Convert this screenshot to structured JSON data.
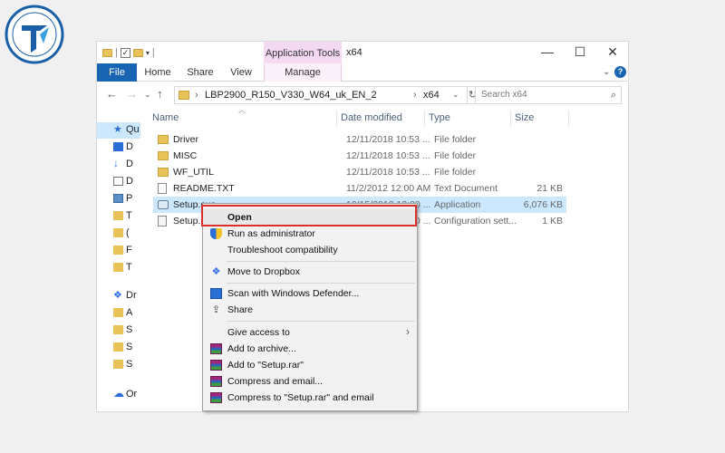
{
  "window": {
    "tools_tab": "Application Tools",
    "title": "x64"
  },
  "window_controls": {
    "minimize": "—",
    "maximize": "☐",
    "close": "✕"
  },
  "ribbon": {
    "tabs": [
      "File",
      "Home",
      "Share",
      "View",
      "Manage"
    ],
    "expand": "⌄",
    "help": "?"
  },
  "address": {
    "path_segments": [
      "LBP2900_R150_V330_W64_uk_EN_2",
      "x64"
    ],
    "separator": "›",
    "search_placeholder": "Search x64"
  },
  "nav_pane": {
    "items": [
      {
        "icon": "star-icon",
        "label": "Qu"
      },
      {
        "icon": "desktop-icon",
        "label": "D"
      },
      {
        "icon": "download-icon",
        "label": "D"
      },
      {
        "icon": "documents-icon",
        "label": "D"
      },
      {
        "icon": "pictures-icon",
        "label": "P"
      },
      {
        "icon": "folder-icon",
        "label": "T"
      },
      {
        "icon": "folder-icon",
        "label": "("
      },
      {
        "icon": "folder-icon",
        "label": "F"
      },
      {
        "icon": "folder-icon",
        "label": "T"
      },
      {
        "icon": "dropbox-icon",
        "label": "Dr"
      },
      {
        "icon": "folder-icon",
        "label": "A"
      },
      {
        "icon": "folder-icon",
        "label": "S"
      },
      {
        "icon": "folder-icon",
        "label": "S"
      },
      {
        "icon": "folder-icon",
        "label": "S"
      },
      {
        "icon": "onedrive-icon",
        "label": "Or"
      }
    ]
  },
  "columns": {
    "name": "Name",
    "date": "Date modified",
    "type": "Type",
    "size": "Size"
  },
  "files": [
    {
      "name": "Driver",
      "date": "12/11/2018 10:53 ...",
      "type": "File folder",
      "size": "",
      "icon": "folder-icon"
    },
    {
      "name": "MISC",
      "date": "12/11/2018 10:53 ...",
      "type": "File folder",
      "size": "",
      "icon": "folder-icon"
    },
    {
      "name": "WF_UTIL",
      "date": "12/11/2018 10:53 ...",
      "type": "File folder",
      "size": "",
      "icon": "folder-icon"
    },
    {
      "name": "README.TXT",
      "date": "11/2/2012 12:00 AM",
      "type": "Text Document",
      "size": "21 KB",
      "icon": "text-file-icon"
    },
    {
      "name": "Setup.exe",
      "date": "10/15/2012 12:00 ...",
      "type": "Application",
      "size": "6,076 KB",
      "icon": "setup-exe-icon"
    },
    {
      "name": "Setup.ini",
      "date": "10/15/2012 12:00 ...",
      "type": "Configuration sett...",
      "size": "1 KB",
      "icon": "config-file-icon"
    }
  ],
  "context_menu": {
    "items": [
      {
        "label": "Open",
        "icon": "",
        "group": 1
      },
      {
        "label": "Run as administrator",
        "icon": "uac-shield-icon",
        "group": 1
      },
      {
        "label": "Troubleshoot compatibility",
        "icon": "",
        "group": 1
      },
      {
        "label": "Move to Dropbox",
        "icon": "dropbox-icon",
        "group": 2
      },
      {
        "label": "Scan with Windows Defender...",
        "icon": "defender-icon",
        "group": 3
      },
      {
        "label": "Share",
        "icon": "share-icon",
        "group": 3
      },
      {
        "label": "Give access to",
        "icon": "",
        "group": 4,
        "submenu": true
      },
      {
        "label": "Add to archive...",
        "icon": "winrar-icon",
        "group": 4
      },
      {
        "label": "Add to \"Setup.rar\"",
        "icon": "winrar-icon",
        "group": 4
      },
      {
        "label": "Compress and email...",
        "icon": "winrar-icon",
        "group": 4
      },
      {
        "label": "Compress to \"Setup.rar\" and email",
        "icon": "winrar-icon",
        "group": 4
      }
    ],
    "submenu_arrow": "›"
  },
  "colors": {
    "file_tab": "#1a64b4",
    "app_tools_tab": "#f3d9f1",
    "selection": "#cce8ff",
    "open_highlight_border": "#d9302b",
    "folder": "#e8c35a"
  }
}
